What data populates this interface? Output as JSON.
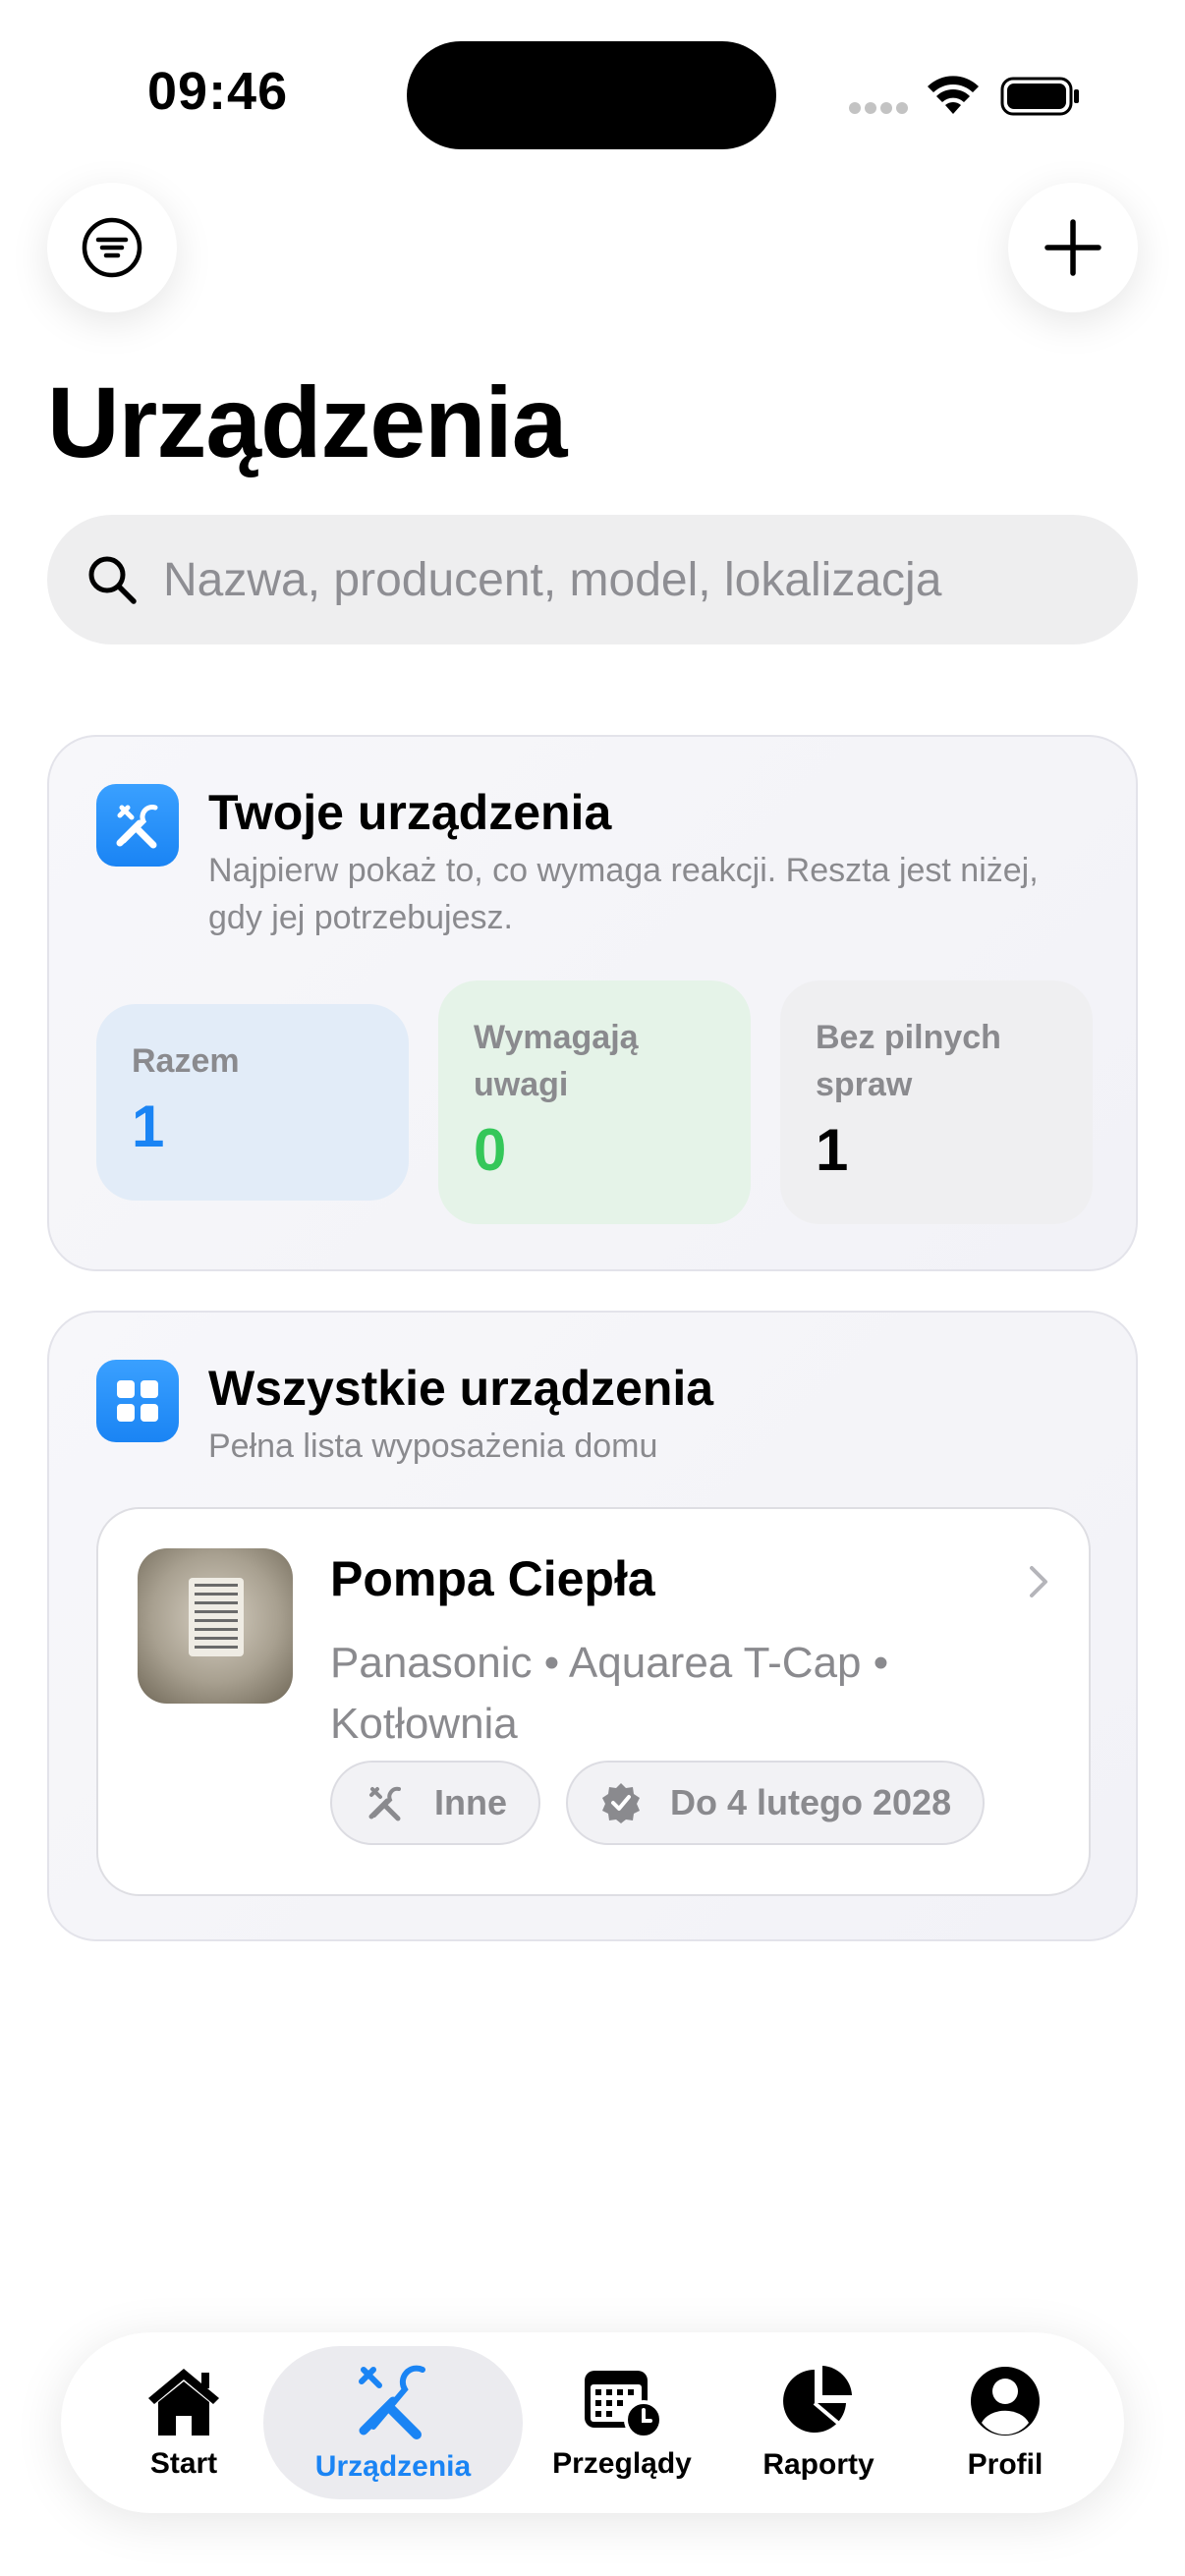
{
  "status_bar": {
    "time": "09:46"
  },
  "header": {
    "title": "Urządzenia"
  },
  "search": {
    "placeholder": "Nazwa, producent, model, lokalizacja"
  },
  "summary_card": {
    "title": "Twoje urządzenia",
    "subtitle": "Najpierw pokaż to, co wymaga reakcji. Reszta jest niżej, gdy jej potrzebujesz.",
    "stats": [
      {
        "label": "Razem",
        "value": "1",
        "color": "#1a84f4"
      },
      {
        "label": "Wymagają uwagi",
        "value": "0",
        "color": "#34c759"
      },
      {
        "label": "Bez pilnych spraw",
        "value": "1",
        "color": "#000000"
      }
    ]
  },
  "all_card": {
    "title": "Wszystkie urządzenia",
    "subtitle": "Pełna lista wyposażenia domu",
    "devices": [
      {
        "name": "Pompa Ciepła",
        "meta": "Panasonic • Aquarea T-Cap • Kotłownia",
        "chips": [
          {
            "label": "Inne",
            "icon": "tools-icon"
          },
          {
            "label": "Do 4 lutego 2028",
            "icon": "verified-badge-icon"
          }
        ]
      }
    ]
  },
  "tabbar": {
    "active": "Urządzenia",
    "accent": "#1a84f4",
    "tabs": [
      {
        "label": "Start",
        "icon": "house-icon"
      },
      {
        "label": "Urządzenia",
        "icon": "tools-icon"
      },
      {
        "label": "Przeglądy",
        "icon": "calendar-clock-icon"
      },
      {
        "label": "Raporty",
        "icon": "pie-chart-icon"
      },
      {
        "label": "Profil",
        "icon": "person-icon"
      }
    ]
  }
}
